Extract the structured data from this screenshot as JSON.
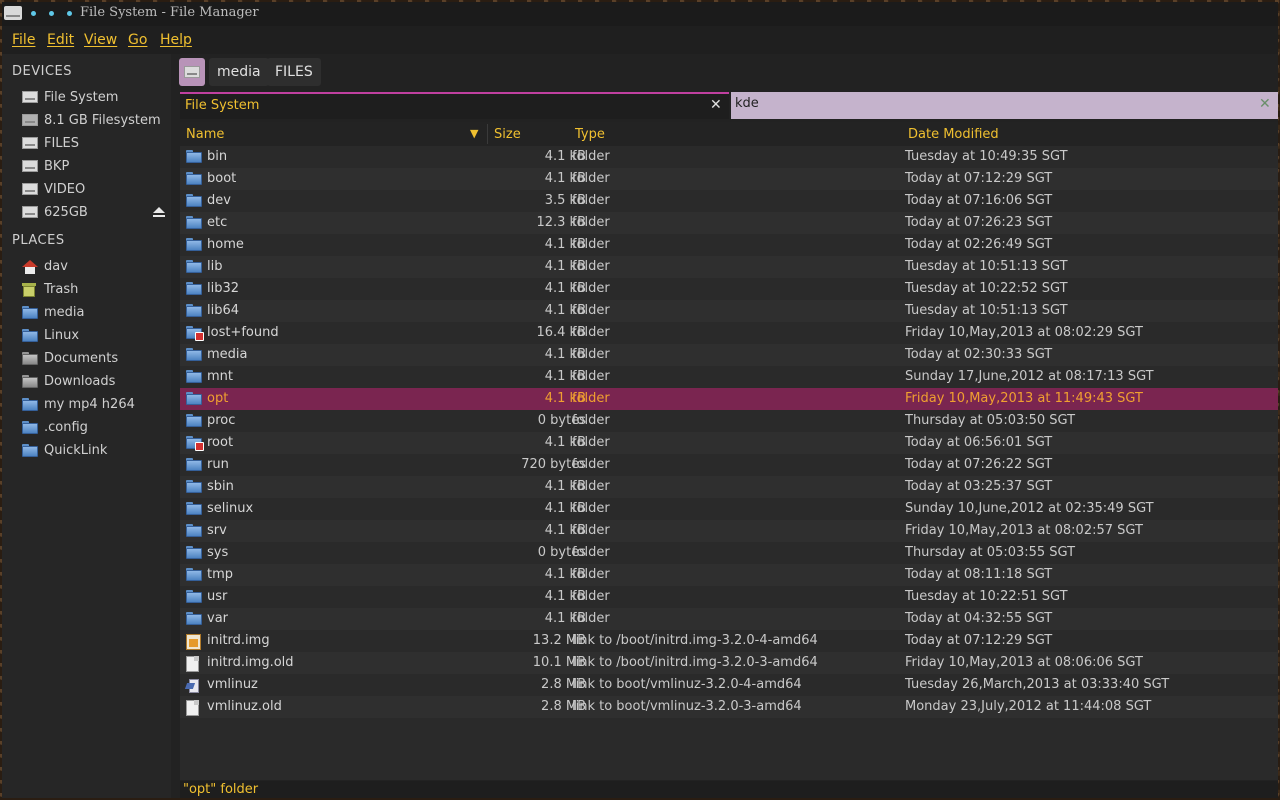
{
  "window": {
    "title": "File System - File Manager",
    "accent_color": "#f0c030",
    "selection_color": "#7a2550"
  },
  "menubar": {
    "items": [
      "File",
      "Edit",
      "View",
      "Go",
      "Help"
    ]
  },
  "sidebar": {
    "devices_heading": "DEVICES",
    "devices": [
      {
        "label": "File System",
        "icon": "drive-icon"
      },
      {
        "label": "8.1 GB Filesystem",
        "icon": "drive-icon"
      },
      {
        "label": "FILES",
        "icon": "drive-icon"
      },
      {
        "label": "BKP",
        "icon": "drive-icon"
      },
      {
        "label": "VIDEO",
        "icon": "drive-icon"
      },
      {
        "label": "625GB",
        "icon": "drive-icon",
        "eject": true
      }
    ],
    "places_heading": "PLACES",
    "places": [
      {
        "label": "dav",
        "icon": "home-icon"
      },
      {
        "label": "Trash",
        "icon": "trash-icon"
      },
      {
        "label": "media",
        "icon": "folder-icon"
      },
      {
        "label": "Linux",
        "icon": "folder-icon"
      },
      {
        "label": "Documents",
        "icon": "documents-folder-icon"
      },
      {
        "label": "Downloads",
        "icon": "downloads-folder-icon"
      },
      {
        "label": "my mp4 h264",
        "icon": "folder-icon"
      },
      {
        "label": ".config",
        "icon": "folder-icon"
      },
      {
        "label": "QuickLink",
        "icon": "folder-icon"
      }
    ]
  },
  "pathbar": {
    "segments": [
      "media",
      "FILES"
    ]
  },
  "tabs": [
    {
      "label": "File System",
      "active": true
    },
    {
      "label": "kde",
      "active": false
    }
  ],
  "list": {
    "columns": {
      "name": "Name",
      "size": "Size",
      "type": "Type",
      "date": "Date Modified"
    },
    "rows": [
      {
        "name": "bin",
        "size": "4.1 kB",
        "type": "folder",
        "date": "Tuesday at 10:49:35  SGT",
        "icon": "folder"
      },
      {
        "name": "boot",
        "size": "4.1 kB",
        "type": "folder",
        "date": "Today at 07:12:29  SGT",
        "icon": "folder"
      },
      {
        "name": "dev",
        "size": "3.5 kB",
        "type": "folder",
        "date": "Today at 07:16:06  SGT",
        "icon": "folder"
      },
      {
        "name": "etc",
        "size": "12.3 kB",
        "type": "folder",
        "date": "Today at 07:26:23  SGT",
        "icon": "folder"
      },
      {
        "name": "home",
        "size": "4.1 kB",
        "type": "folder",
        "date": "Today at 02:26:49  SGT",
        "icon": "folder"
      },
      {
        "name": "lib",
        "size": "4.1 kB",
        "type": "folder",
        "date": "Tuesday at 10:51:13  SGT",
        "icon": "folder"
      },
      {
        "name": "lib32",
        "size": "4.1 kB",
        "type": "folder",
        "date": "Tuesday at 10:22:52  SGT",
        "icon": "folder"
      },
      {
        "name": "lib64",
        "size": "4.1 kB",
        "type": "folder",
        "date": "Tuesday at 10:51:13  SGT",
        "icon": "folder"
      },
      {
        "name": "lost+found",
        "size": "16.4 kB",
        "type": "folder",
        "date": "Friday 10,May,2013 at 08:02:29  SGT",
        "icon": "folder-locked"
      },
      {
        "name": "media",
        "size": "4.1 kB",
        "type": "folder",
        "date": "Today at 02:30:33  SGT",
        "icon": "folder"
      },
      {
        "name": "mnt",
        "size": "4.1 kB",
        "type": "folder",
        "date": "Sunday 17,June,2012 at 08:17:13  SGT",
        "icon": "folder"
      },
      {
        "name": "opt",
        "size": "4.1 kB",
        "type": "folder",
        "date": "Friday 10,May,2013 at 11:49:43  SGT",
        "icon": "folder",
        "selected": true
      },
      {
        "name": "proc",
        "size": "0 bytes",
        "type": "folder",
        "date": "Thursday at 05:03:50  SGT",
        "icon": "folder"
      },
      {
        "name": "root",
        "size": "4.1 kB",
        "type": "folder",
        "date": "Today at 06:56:01  SGT",
        "icon": "folder-locked"
      },
      {
        "name": "run",
        "size": "720 bytes",
        "type": "folder",
        "date": "Today at 07:26:22  SGT",
        "icon": "folder"
      },
      {
        "name": "sbin",
        "size": "4.1 kB",
        "type": "folder",
        "date": "Today at 03:25:37  SGT",
        "icon": "folder"
      },
      {
        "name": "selinux",
        "size": "4.1 kB",
        "type": "folder",
        "date": "Sunday 10,June,2012 at 02:35:49  SGT",
        "icon": "folder"
      },
      {
        "name": "srv",
        "size": "4.1 kB",
        "type": "folder",
        "date": "Friday 10,May,2013 at 08:02:57  SGT",
        "icon": "folder"
      },
      {
        "name": "sys",
        "size": "0 bytes",
        "type": "folder",
        "date": "Thursday at 05:03:55  SGT",
        "icon": "folder"
      },
      {
        "name": "tmp",
        "size": "4.1 kB",
        "type": "folder",
        "date": "Today at 08:11:18  SGT",
        "icon": "folder"
      },
      {
        "name": "usr",
        "size": "4.1 kB",
        "type": "folder",
        "date": "Tuesday at 10:22:51  SGT",
        "icon": "folder"
      },
      {
        "name": "var",
        "size": "4.1 kB",
        "type": "folder",
        "date": "Today at 04:32:55  SGT",
        "icon": "folder"
      },
      {
        "name": "initrd.img",
        "size": "13.2 MB",
        "type": "link to /boot/initrd.img-3.2.0-4-amd64",
        "date": "Today at 07:12:29  SGT",
        "icon": "image"
      },
      {
        "name": "initrd.img.old",
        "size": "10.1 MB",
        "type": "link to /boot/initrd.img-3.2.0-3-amd64",
        "date": "Friday 10,May,2013 at 08:06:06  SGT",
        "icon": "file"
      },
      {
        "name": "vmlinuz",
        "size": "2.8 MB",
        "type": "link to boot/vmlinuz-3.2.0-4-amd64",
        "date": "Tuesday 26,March,2013 at 03:33:40  SGT",
        "icon": "exec"
      },
      {
        "name": "vmlinuz.old",
        "size": "2.8 MB",
        "type": "link to boot/vmlinuz-3.2.0-3-amd64",
        "date": "Monday 23,July,2012 at 11:44:08  SGT",
        "icon": "file"
      }
    ]
  },
  "statusbar": {
    "text": "\"opt\" folder"
  }
}
